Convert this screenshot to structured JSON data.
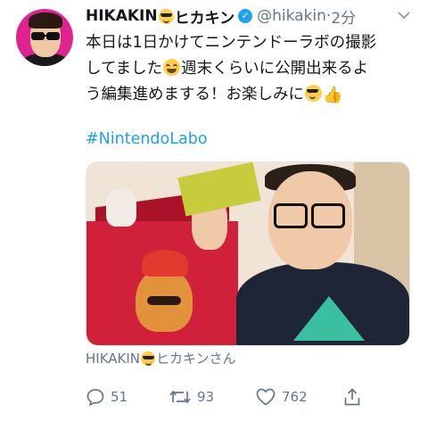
{
  "tweet": {
    "display_name": "HIKAKIN",
    "display_name_suffix": "ヒカキン",
    "handle": "@hikakin",
    "separator": "·",
    "timestamp": "2分",
    "text_lines": [
      "本日は1日かけてニンテンドーラボの撮影",
      "してました",
      "週末くらいに公開出来るよ",
      "う編集進めまする！お楽しみに"
    ],
    "hashtag": "#NintendoLabo",
    "media_caption_name": "HIKAKIN",
    "media_caption_suffix": "ヒカキンさん",
    "actions": {
      "reply_count": "51",
      "retweet_count": "93",
      "like_count": "762"
    }
  },
  "icons": {
    "sunglasses_emoji": "smiling-face-with-sunglasses",
    "laughing_emoji": "grinning-squinting-face",
    "thumbs_up_emoji": "thumbs-up",
    "verified": "verified-badge",
    "more": "chevron-down",
    "reply": "speech-bubble",
    "retweet": "retweet-arrows",
    "like": "heart",
    "share": "share-upload"
  },
  "colors": {
    "accent": "#1da1f2",
    "secondary_text": "#657786",
    "primary_text": "#14171a",
    "avatar_bg": "#e0248f"
  }
}
